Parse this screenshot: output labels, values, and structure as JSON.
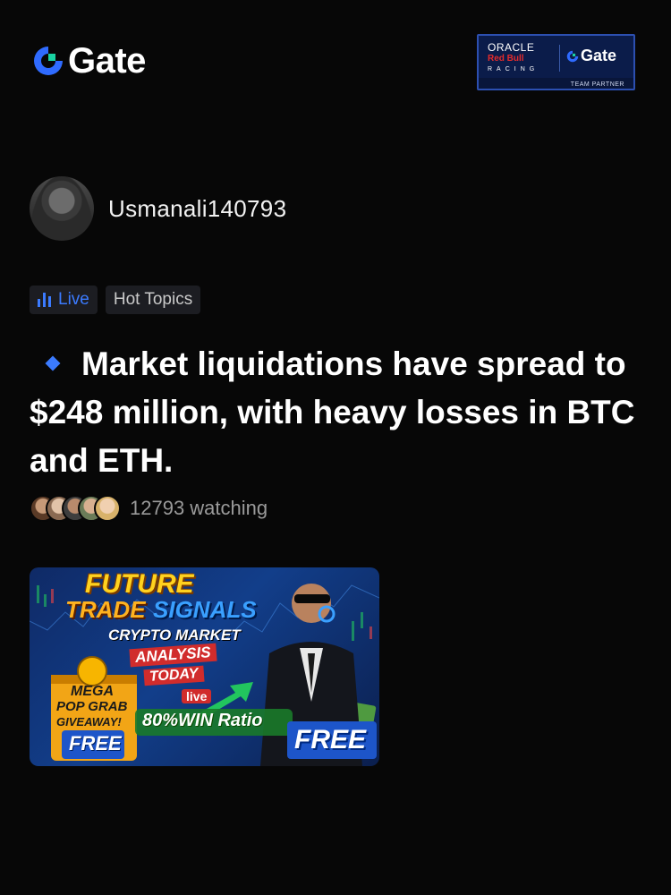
{
  "header": {
    "brand_name": "Gate",
    "brand_icon": "gate-logo-icon",
    "partner_badge": {
      "oracle": "ORACLE",
      "redbull": "Red Bull",
      "racing": "RACING",
      "gate": "Gate",
      "tag": "TEAM PARTNER"
    }
  },
  "user": {
    "username": "Usmanali140793"
  },
  "tags": {
    "live_label": "Live",
    "hot_label": "Hot Topics"
  },
  "post": {
    "headline": "Market liquidations have spread to $248 million, with heavy losses in BTC and ETH."
  },
  "watching": {
    "text": "12793 watching"
  },
  "banner": {
    "future": "FUTURE",
    "trade": "TRADE",
    "signals": "SIGNALS",
    "crypto_market": "CRYPTO MARKET",
    "analysis": "ANALYSIS",
    "today": "TODAY",
    "live": "live",
    "mega": "MEGA",
    "pop_grab": "POP GRAB",
    "giveaway": "GIVEAWAY!",
    "free_left": "FREE",
    "win_ratio": "80%WIN Ratio",
    "free_right": "FREE"
  },
  "colors": {
    "background": "#070707",
    "accent_blue": "#3b7bff",
    "tag_bg": "#1c1d22",
    "muted_text": "#9a9a9a"
  }
}
